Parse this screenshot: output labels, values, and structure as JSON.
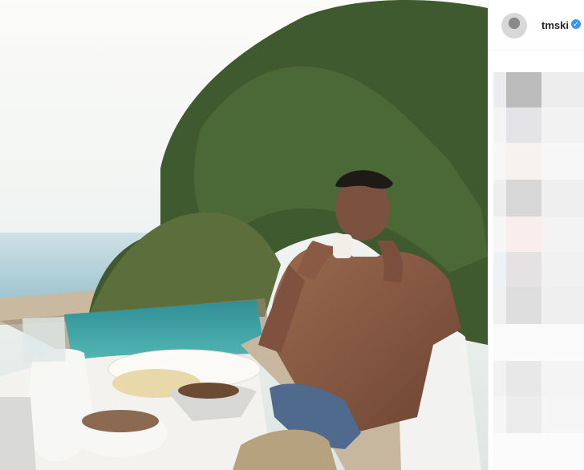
{
  "post": {
    "username": "tmski",
    "verified_glyph": "✓",
    "image_alt": "Photo"
  },
  "icons": {
    "avatar": "avatar",
    "verified": "verified-badge-icon"
  },
  "colors": {
    "accent": "#3897f0",
    "text": "#262626",
    "border": "#efefef"
  }
}
